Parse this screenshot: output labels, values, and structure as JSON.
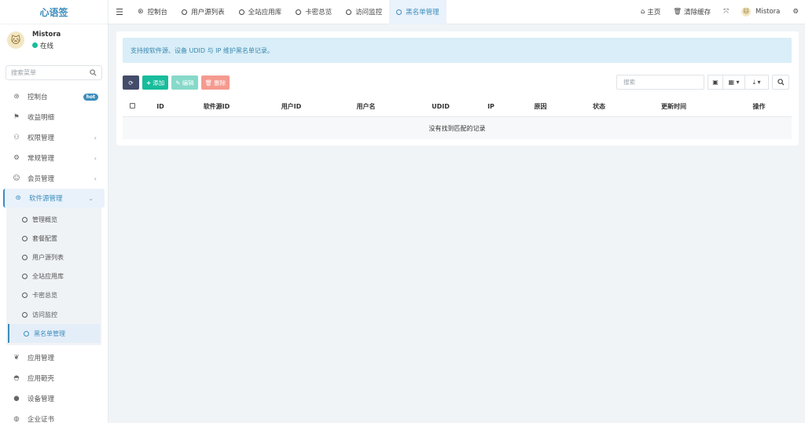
{
  "app": {
    "logo_text": "心语签"
  },
  "user": {
    "name": "Mistora",
    "status": "在线",
    "avatar_glyph": "🐱"
  },
  "sidebar": {
    "search_placeholder": "搜索菜单",
    "items": [
      {
        "label": "控制台",
        "icon": "dashboard-icon",
        "glyph": "⊛",
        "badge": "hot"
      },
      {
        "label": "收益明细",
        "icon": "flag-icon",
        "glyph": "⚑"
      },
      {
        "label": "权限管理",
        "icon": "group-icon",
        "glyph": "⚇",
        "chevron": "‹"
      },
      {
        "label": "常规管理",
        "icon": "cogs-icon",
        "glyph": "⚙",
        "chevron": "‹"
      },
      {
        "label": "会员管理",
        "icon": "user-circle-icon",
        "glyph": "☺",
        "chevron": "‹"
      },
      {
        "label": "软件源管理",
        "icon": "dashboard-icon",
        "glyph": "⊛",
        "chevron": "⌄"
      }
    ],
    "submenu": [
      {
        "label": "管理概览"
      },
      {
        "label": "套餐配置"
      },
      {
        "label": "用户源列表"
      },
      {
        "label": "全站应用库"
      },
      {
        "label": "卡密总览"
      },
      {
        "label": "访问监控"
      },
      {
        "label": "黑名单管理"
      }
    ],
    "items_after": [
      {
        "label": "应用管理",
        "icon": "leaf-icon",
        "glyph": "❦"
      },
      {
        "label": "应用砸壳",
        "icon": "shell-icon",
        "glyph": "◓"
      },
      {
        "label": "设备管理",
        "icon": "device-icon",
        "glyph": "●"
      },
      {
        "label": "企业证书",
        "icon": "globe-icon",
        "glyph": "◍"
      }
    ]
  },
  "topbar": {
    "tabs": [
      {
        "label": "控制台",
        "icon": "dashboard-icon",
        "glyph": "⊛"
      },
      {
        "label": "用户源列表"
      },
      {
        "label": "全站应用库"
      },
      {
        "label": "卡密总览"
      },
      {
        "label": "访问监控"
      },
      {
        "label": "黑名单管理"
      }
    ],
    "home_label": "主页",
    "clear_cache_label": "清除缓存",
    "user_name": "Mistora"
  },
  "page": {
    "notice": "支持按软件源、设备 UDID 与 IP 维护黑名单记录。",
    "buttons": {
      "add": "添加",
      "edit": "编辑",
      "delete": "删除"
    },
    "search_placeholder": "搜索",
    "table": {
      "columns": [
        "ID",
        "软件源ID",
        "用户ID",
        "用户名",
        "UDID",
        "IP",
        "原因",
        "状态",
        "更新时间",
        "操作"
      ],
      "empty_text": "没有找到匹配的记录"
    }
  },
  "colors": {
    "primary": "#3c8dbc",
    "success": "#18bc9c",
    "danger": "#f59a8f",
    "dark": "#444c6b"
  }
}
